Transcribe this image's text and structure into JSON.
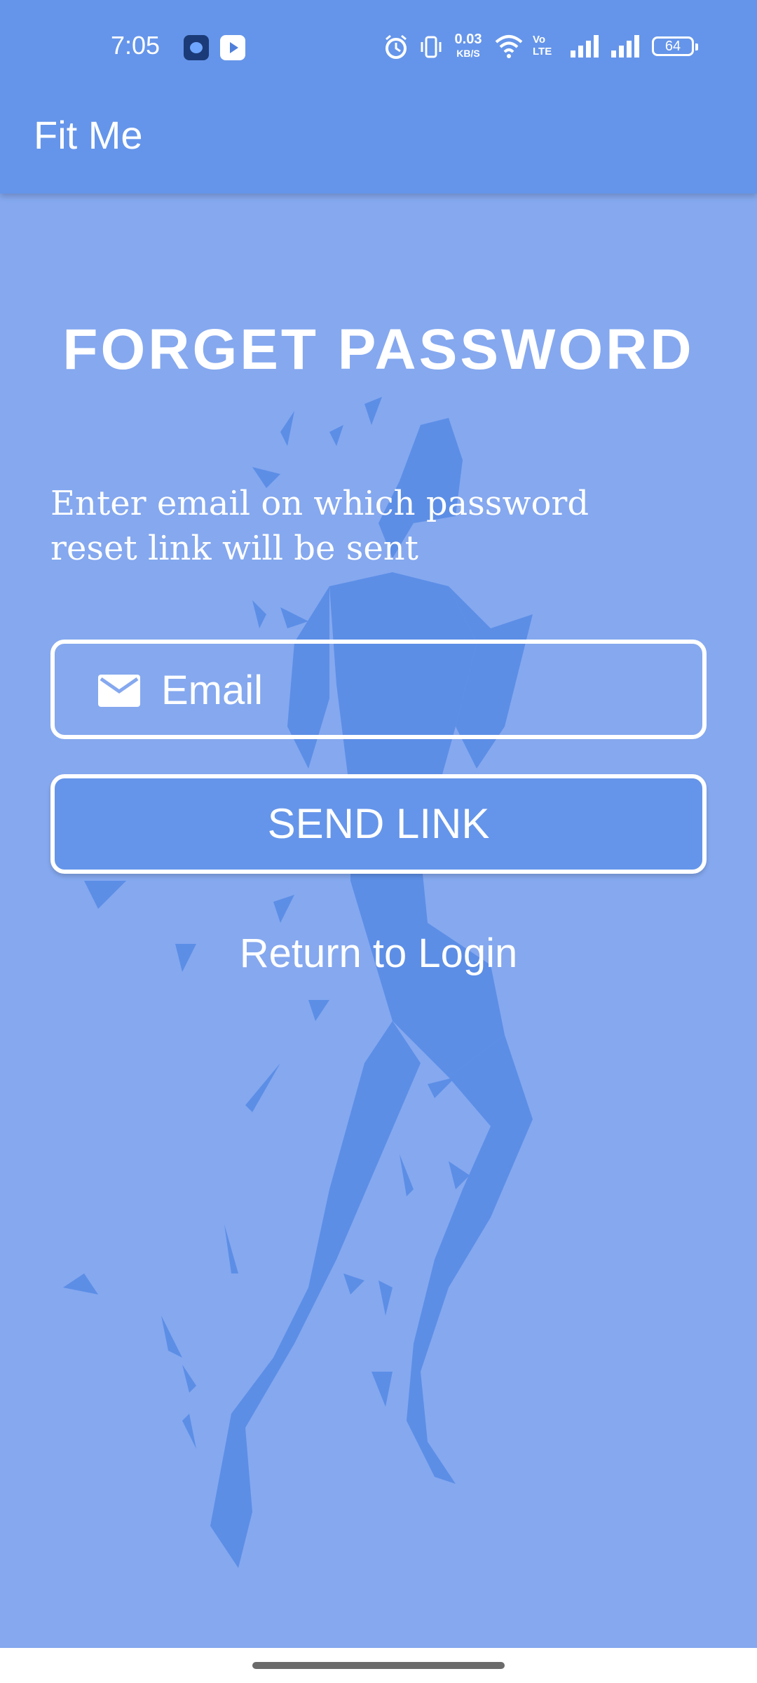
{
  "status_bar": {
    "time": "7:05",
    "net_speed_value": "0.03",
    "net_speed_unit": "KB/S",
    "volte_label": "Vo LTE",
    "battery_level": "64"
  },
  "app_bar": {
    "title": "Fit Me"
  },
  "main": {
    "heading": "FORGET PASSWORD",
    "description": "Enter email on which password reset link will be sent",
    "email": {
      "placeholder": "Email",
      "value": ""
    },
    "send_button_label": "SEND LINK",
    "return_link_label": "Return to Login"
  },
  "colors": {
    "app_bar": "#6595ea",
    "background": "#85a8ef",
    "silhouette": "#4f86e3",
    "button": "#6595ea",
    "text": "#ffffff"
  },
  "icons": {
    "email_field": "mail-icon",
    "status": [
      "alarm-icon",
      "vibrate-icon",
      "wifi-icon",
      "signal-icon",
      "battery-icon"
    ]
  }
}
